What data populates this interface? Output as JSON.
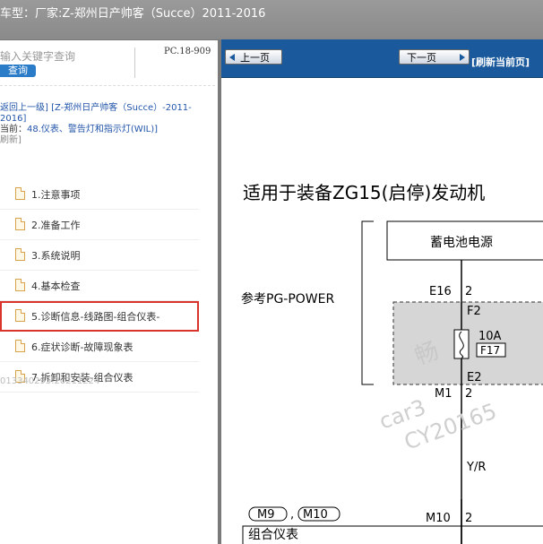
{
  "window": {
    "title": "车型：厂家:Z-郑州日产帅客（Succe）2011-2016"
  },
  "left_panel": {
    "search": {
      "placeholder": "输入关键字查询",
      "button_label": "查询"
    },
    "code": "PC.18-909",
    "breadcrumb": {
      "back_link": "返回上一级]",
      "model": "[Z-郑州日产帅客（Succe）-2011-2016]",
      "current_prefix": "当前：",
      "current_value": "48.仪表、警告灯和指示灯(WIL)]",
      "refresh": "刷新]"
    },
    "menu_items": [
      {
        "label": "1.注意事项",
        "icon": "document-icon"
      },
      {
        "label": "2.准备工作",
        "icon": "document-icon"
      },
      {
        "label": "3.系统说明",
        "icon": "document-icon"
      },
      {
        "label": "4.基本检查",
        "icon": "document-icon"
      },
      {
        "label": "5.诊断信息-线路图-组合仪表-",
        "icon": "document-icon",
        "selected": true
      },
      {
        "label": "6.症状诊断-故障现象表",
        "icon": "document-icon"
      },
      {
        "label": "7.拆卸和安装-组合仪表",
        "icon": "document-icon"
      }
    ],
    "version": "013340295.20211224"
  },
  "viewer": {
    "prev_label": "上一页",
    "next_label": "下一页",
    "refresh_label": "[刷新当前页]"
  },
  "diagram": {
    "title": "适用于装备ZG15(启停)发动机",
    "battery_label": "蓄电池电源",
    "ref_label": "参考PG-POWER",
    "e16": "E16",
    "e16_pin": "2",
    "f2": "F2",
    "fuse_rating": "10A",
    "fuse_id": "F17",
    "e2": "E2",
    "m1": "M1",
    "m1_pin": "2",
    "wire_color": "Y/R",
    "meter_label": "组合仪表",
    "conn_m9": "M9",
    "comma": ",",
    "conn_m10": "M10",
    "m10": "M10",
    "m10_pin": "2",
    "watermark_1": "畅",
    "watermark_2": "car3",
    "watermark_3": "CY20165"
  },
  "colors": {
    "titlebar": "#8f8f8f",
    "nav_bar": "#1a5a9c",
    "selected_outline": "#d9342b",
    "link": "#2255aa"
  }
}
